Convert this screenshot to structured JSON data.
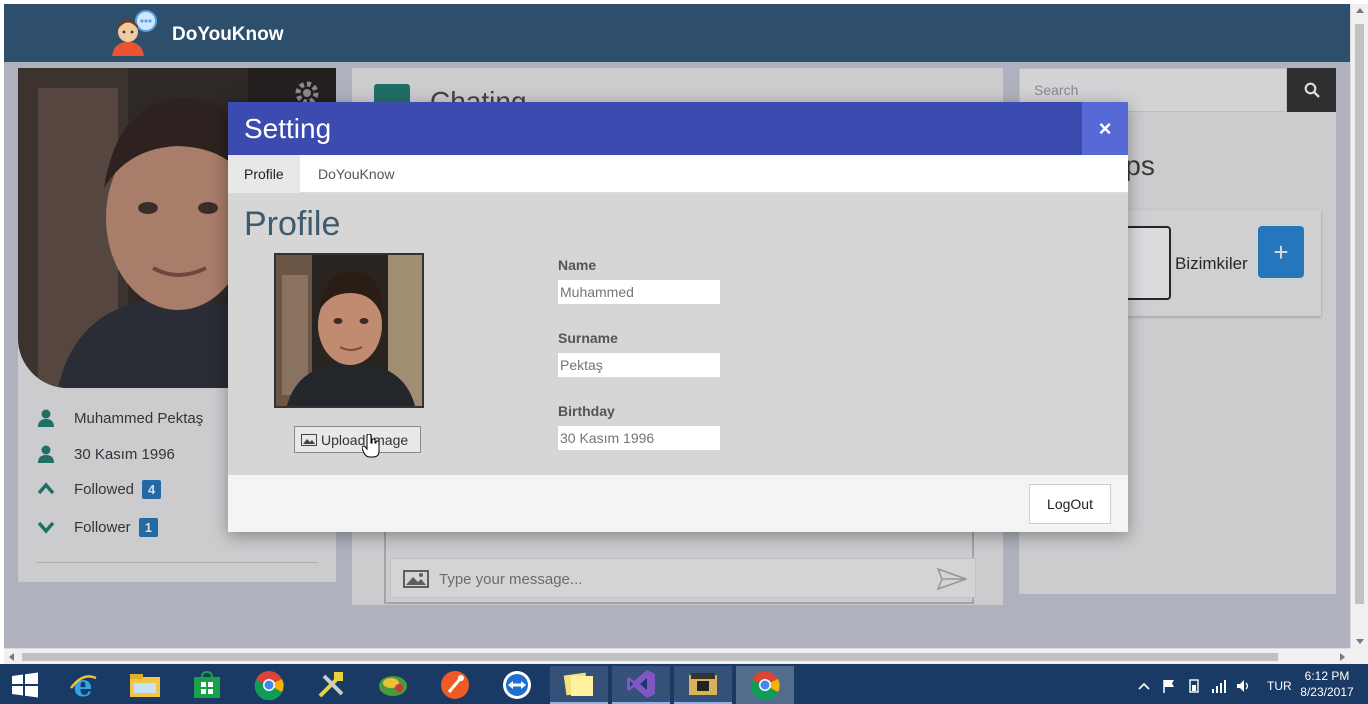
{
  "app": {
    "name": "DoYouKnow"
  },
  "profile_card": {
    "full_name": "Muhammed Pektaş",
    "birthday": "30 Kasım 1996",
    "followed_label": "Followed",
    "followed_count": "4",
    "follower_label": "Follower",
    "follower_count": "1"
  },
  "chat": {
    "title": "Chating",
    "input_placeholder": "Type your message..."
  },
  "groups": {
    "search_placeholder": "Search",
    "title": "yGroups",
    "items": [
      {
        "name": "Bizimkiler"
      }
    ],
    "add_label": "+"
  },
  "modal": {
    "title": "Setting",
    "close_label": "×",
    "tabs": [
      {
        "label": "Profile",
        "active": true
      },
      {
        "label": "DoYouKnow",
        "active": false
      }
    ],
    "section_title": "Profile",
    "upload_label": "Upload Image",
    "fields": {
      "name_label": "Name",
      "name_value": "Muhammed",
      "surname_label": "Surname",
      "surname_value": "Pektaş",
      "birthday_label": "Birthday",
      "birthday_value": "30 Kasım 1996"
    },
    "logout_label": "LogOut"
  },
  "taskbar": {
    "apps": [
      "windows-start",
      "internet-explorer",
      "file-explorer",
      "windows-store",
      "chrome",
      "tools",
      "game",
      "postman",
      "teamviewer",
      "sticky-notes",
      "visual-studio",
      "tool-app",
      "chrome-active"
    ],
    "language": "TUR",
    "time": "6:12 PM",
    "date": "8/23/2017"
  },
  "colors": {
    "navbar": "#2d4f6c",
    "modal_header": "#3b4bb0",
    "modal_close": "#5669d6",
    "badge": "#1f73b7",
    "add_button": "#1f84d6",
    "taskbar": "#1a3a66"
  }
}
